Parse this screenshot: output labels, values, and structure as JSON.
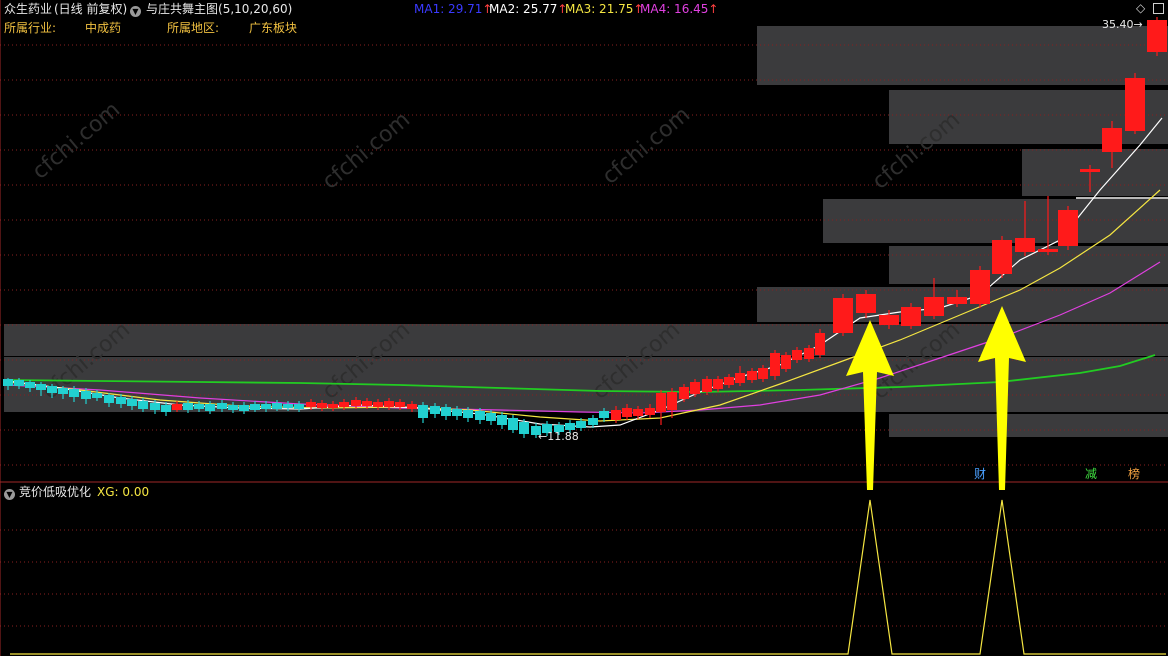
{
  "header": {
    "stock_name": "众生药业",
    "period_label": "(日线 前复权)",
    "indicator_title": "与庄共舞主图",
    "indicator_params": "(5,10,20,60)",
    "ma1": "MA1: 29.71",
    "ma2": "MA2: 25.77",
    "ma3": "MA3: 21.75",
    "ma4": "MA4: 16.45",
    "up_arrow": "↑",
    "colors": {
      "ma1": "#3a3aff",
      "ma2": "#ffffff",
      "ma3": "#f5e642",
      "ma4": "#e040e0",
      "arrow": "#ff4040"
    }
  },
  "info": {
    "industry_label": "所属行业:",
    "industry_value": "中成药",
    "region_label": "所属地区:",
    "region_value": "广东板块"
  },
  "chart": {
    "price_high_label": "35.40",
    "price_low_label": "11.88",
    "markers": {
      "cai": "财",
      "jian": "减",
      "bang": "榜"
    },
    "colors": {
      "up": "#ff1a1a",
      "down": "#22d0d0",
      "ma60": "#22cc22",
      "ma20": "#e040e0",
      "ma10": "#f5e642",
      "ma5": "#ffffff",
      "arrow": "#ffff00",
      "band": "#3b3b3d"
    }
  },
  "watermark": "cfchi.com",
  "indicator_panel": {
    "name": "竞价低吸优化",
    "xg_value": "XG: 0.00"
  },
  "chart_data": {
    "type": "candlestick",
    "title": "与庄共舞主图 众生药业 (日线 前复权)",
    "annotations": [
      "35.40",
      "11.88"
    ],
    "series": [
      {
        "name": "MA1",
        "value": 29.71
      },
      {
        "name": "MA2",
        "value": 25.77
      },
      {
        "name": "MA3",
        "value": 21.75
      },
      {
        "name": "MA4",
        "value": 16.45
      }
    ],
    "indicator": {
      "name": "竞价低吸优化",
      "XG": 0.0,
      "signals": 2
    }
  }
}
